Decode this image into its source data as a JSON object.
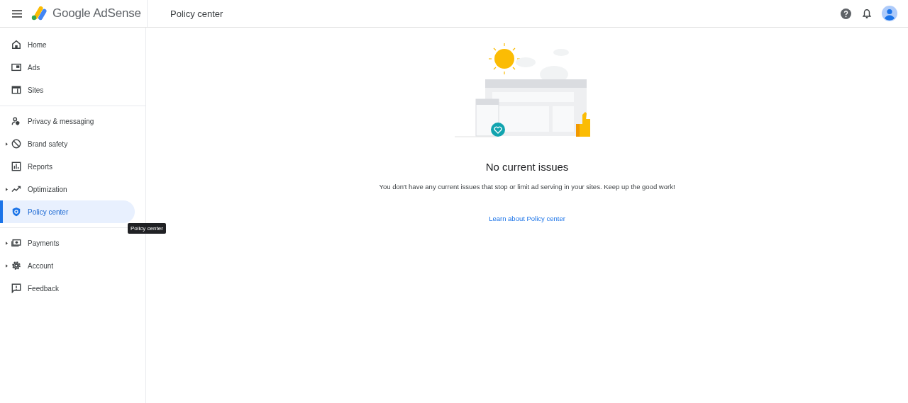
{
  "header": {
    "product": "Google AdSense",
    "page_title": "Policy center"
  },
  "sidebar": {
    "groups": [
      {
        "items": [
          {
            "label": "Home",
            "expandable": false,
            "selected": false
          },
          {
            "label": "Ads",
            "expandable": false,
            "selected": false
          },
          {
            "label": "Sites",
            "expandable": false,
            "selected": false
          }
        ]
      },
      {
        "items": [
          {
            "label": "Privacy & messaging",
            "expandable": false,
            "selected": false
          },
          {
            "label": "Brand safety",
            "expandable": true,
            "selected": false
          },
          {
            "label": "Reports",
            "expandable": false,
            "selected": false
          },
          {
            "label": "Optimization",
            "expandable": true,
            "selected": false
          },
          {
            "label": "Policy center",
            "expandable": false,
            "selected": true
          }
        ]
      },
      {
        "items": [
          {
            "label": "Payments",
            "expandable": true,
            "selected": false
          },
          {
            "label": "Account",
            "expandable": true,
            "selected": false
          },
          {
            "label": "Feedback",
            "expandable": false,
            "selected": false
          }
        ]
      }
    ]
  },
  "tooltip": "Policy center",
  "main": {
    "heading": "No current issues",
    "message": "You don't have any current issues that stop or limit ad serving in your sites. Keep up the good work!",
    "link": "Learn about Policy center"
  }
}
